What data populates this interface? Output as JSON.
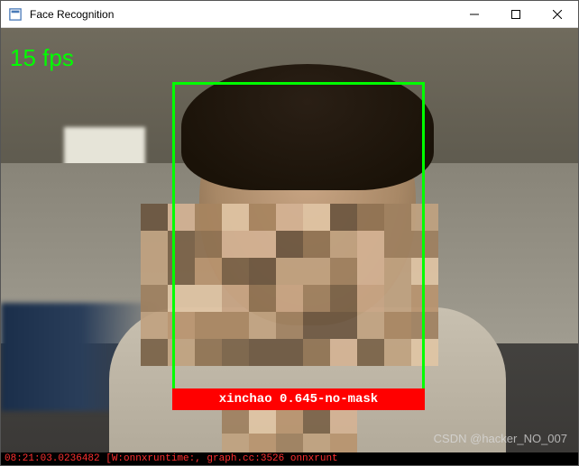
{
  "window": {
    "title": "Face Recognition"
  },
  "overlay": {
    "fps_text": "15 fps"
  },
  "detection": {
    "label_text": "xinchao 0.645-no-mask",
    "name": "xinchao",
    "confidence": 0.645,
    "class": "no-mask",
    "box_color": "#00ff00",
    "label_bg": "#ff0000",
    "label_fg": "#ffffff"
  },
  "watermark": {
    "text": "CSDN @hacker_NO_007"
  },
  "log": {
    "line": "08:21:03.0236482 [W:onnxruntime:, graph.cc:3526 onnxrunt"
  }
}
